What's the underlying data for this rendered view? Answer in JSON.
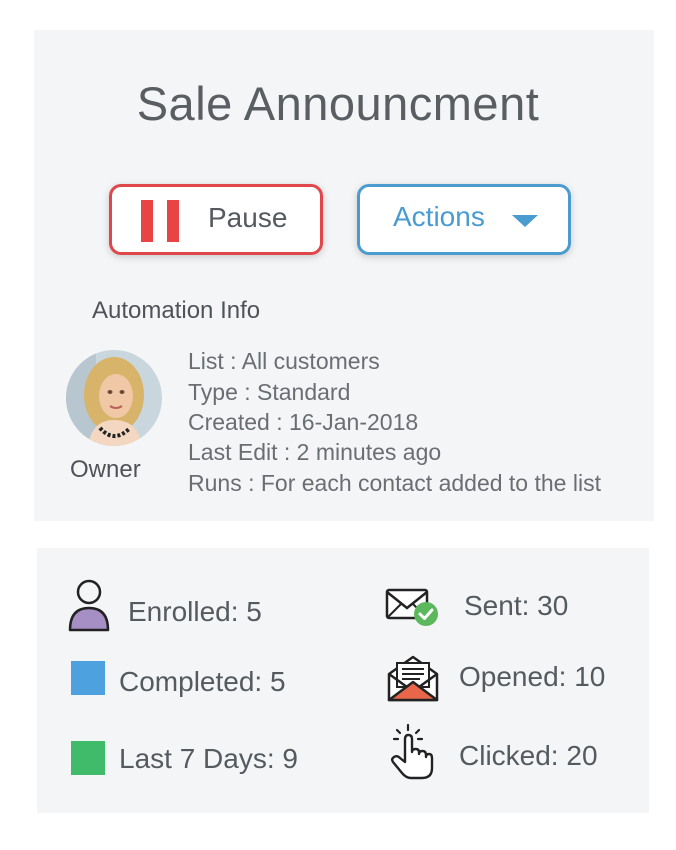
{
  "header": {
    "title": "Sale Announcment"
  },
  "buttons": {
    "pause_label": "Pause",
    "actions_label": "Actions"
  },
  "automation": {
    "section_title": "Automation Info",
    "owner_label": "Owner",
    "lines": [
      "List : All customers",
      "Type : Standard",
      "Created : 16-Jan-2018",
      "Last Edit : 2 minutes ago",
      "Runs : For each contact added to the list"
    ]
  },
  "stats": {
    "enrolled": "Enrolled: 5",
    "completed": "Completed: 5",
    "last7": "Last 7 Days: 9",
    "sent": "Sent: 30",
    "opened": "Opened: 10",
    "clicked": "Clicked: 20"
  },
  "colors": {
    "pause_red": "#e84446",
    "actions_blue": "#4a9bd0",
    "completed_blue": "#4ea1df",
    "last7_green": "#3fbb6a",
    "enrolled_purple": "#a58fc4",
    "check_green": "#5cb85c",
    "opened_orange": "#e8674b"
  },
  "icons": {
    "enrolled": "user-icon",
    "sent": "envelope-check-icon",
    "opened": "open-envelope-icon",
    "clicked": "hand-tap-icon"
  }
}
